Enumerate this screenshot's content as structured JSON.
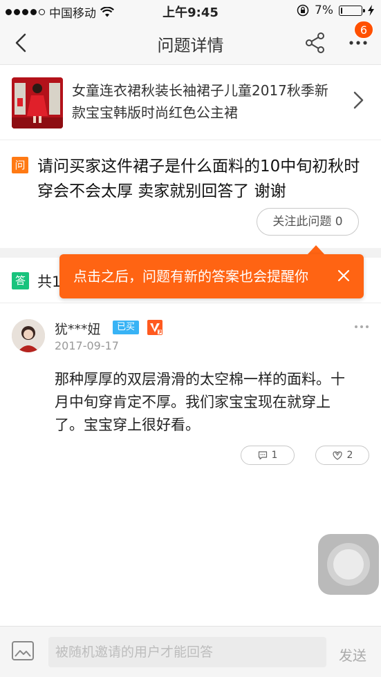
{
  "status_bar": {
    "carrier": "中国移动",
    "time": "上午9:45",
    "battery_percent": "7%",
    "battery_level": 0.07
  },
  "nav": {
    "title": "问题详情",
    "badge_count": "6"
  },
  "product": {
    "title": "女童连衣裙秋装长袖裙子儿童2017秋季新款宝宝韩版时尚红色公主裙"
  },
  "question": {
    "tag": "问",
    "text": "请问买家这件裙子是什么面料的10中旬初秋时穿会不会太厚 卖家就别回答了 谢谢",
    "follow_label": "关注此问题 0"
  },
  "answers_header": {
    "tag": "答",
    "count_text": "共1"
  },
  "tooltip": {
    "text": "点击之后，问题有新的答案也会提醒你"
  },
  "answer": {
    "user": "犹***妞",
    "bought_badge": "已买",
    "date": "2017-09-17",
    "text": "那种厚厚的双层滑滑的太空棉一样的面料。十月中旬穿肯定不厚。我们家宝宝现在就穿上了。宝宝穿上很好看。",
    "comment_count": "1",
    "like_count": "2"
  },
  "bottom_bar": {
    "placeholder": "被随机邀请的用户才能回答",
    "send_label": "发送"
  },
  "colors": {
    "accent_orange": "#ff6413",
    "question_tag": "#ff7a14",
    "answer_tag": "#19c37d",
    "bought_badge": "#38b3f5"
  }
}
